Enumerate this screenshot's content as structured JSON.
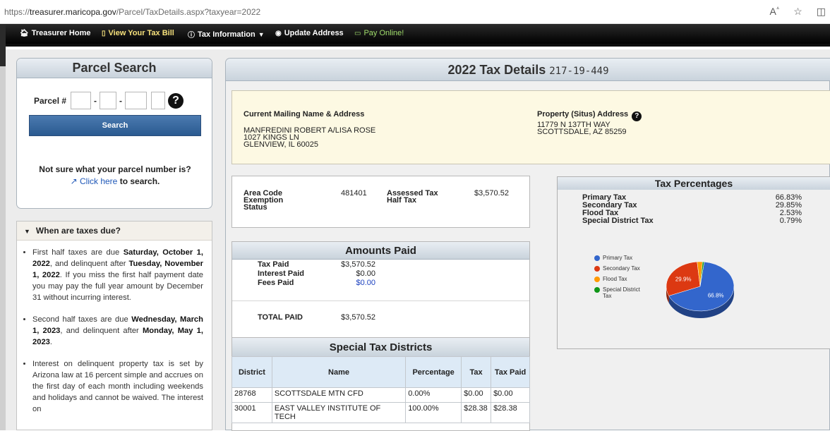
{
  "browser": {
    "url_prefix": "https://",
    "url_host": "treasurer.maricopa.gov",
    "url_path": "/Parcel/TaxDetails.aspx?taxyear=2022"
  },
  "nav": {
    "home": "Treasurer Home",
    "bill": "View Your Tax Bill",
    "taxinfo": "Tax Information",
    "update": "Update Address",
    "pay": "Pay Online!"
  },
  "parcel_search": {
    "title": "Parcel Search",
    "label": "Parcel #",
    "search_button": "Search",
    "not_sure": "Not sure what your parcel number is?",
    "click_here": "Click here",
    "to_search": " to search."
  },
  "taxes_due": {
    "title": "When are taxes due?",
    "items": [
      {
        "a": "First half taxes are due ",
        "b1": "Saturday, October 1, 2022",
        "c": ", and delinquent after ",
        "b2": "Tuesday, November 1, 2022",
        "d": ". If you miss the first half payment date you may pay the full year amount by December 31 without incurring interest."
      },
      {
        "a": "Second half taxes are due ",
        "b1": "Wednesday, March 1, 2023",
        "c": ", and delinquent after ",
        "b2": "Monday, May 1, 2023",
        "d": "."
      },
      {
        "a": "Interest on delinquent property tax is set by Arizona law at 16 percent simple and accrues on the first day of each month including weekends and holidays and cannot be waived. The interest on"
      }
    ]
  },
  "details": {
    "title": "2022 Tax Details",
    "parcel_number": "217-19-449",
    "mailing_header": "Current Mailing Name & Address",
    "mailing_lines": [
      "MANFREDINI ROBERT A/LISA ROSE",
      "1027 KINGS LN",
      "GLENVIEW, IL 60025"
    ],
    "property_header": "Property (Situs) Address",
    "property_lines": [
      "11779 N 137TH WAY",
      "SCOTTSDALE, AZ 85259"
    ],
    "area_code_label": "Area Code",
    "area_code": "481401",
    "exemption_label": "Exemption",
    "status_label": "Status",
    "assessed_label": "Assessed Tax",
    "assessed": "$3,570.52",
    "half_label": "Half Tax"
  },
  "amounts_paid": {
    "title": "Amounts Paid",
    "tax_paid_label": "Tax Paid",
    "tax_paid": "$3,570.52",
    "interest_label": "Interest Paid",
    "interest": "$0.00",
    "fees_label": "Fees Paid",
    "fees": "$0.00",
    "total_label": "TOTAL PAID",
    "total": "$3,570.52"
  },
  "special_districts": {
    "title": "Special Tax Districts",
    "headers": [
      "District",
      "Name",
      "Percentage",
      "Tax",
      "Tax Paid"
    ],
    "rows": [
      [
        "28768",
        "SCOTTSDALE MTN CFD",
        "0.00%",
        "$0.00",
        "$0.00"
      ],
      [
        "30001",
        "EAST VALLEY INSTITUTE OF TECH",
        "100.00%",
        "$28.38",
        "$28.38"
      ]
    ]
  },
  "tax_percentages": {
    "title": "Tax Percentages",
    "rows": [
      {
        "label": "Primary Tax",
        "value": "66.83%"
      },
      {
        "label": "Secondary Tax",
        "value": "29.85%"
      },
      {
        "label": "Flood Tax",
        "value": "2.53%"
      },
      {
        "label": "Special District Tax",
        "value": "0.79%"
      }
    ]
  },
  "chart_data": {
    "type": "pie",
    "categories": [
      "Primary Tax",
      "Secondary Tax",
      "Flood Tax",
      "Special District Tax"
    ],
    "values": [
      66.83,
      29.85,
      2.53,
      0.79
    ],
    "colors": [
      "#3366cc",
      "#dc3912",
      "#ff9900",
      "#109618"
    ],
    "data_labels": [
      "66.8%",
      "29.9%",
      "",
      ""
    ],
    "legend": "left"
  }
}
